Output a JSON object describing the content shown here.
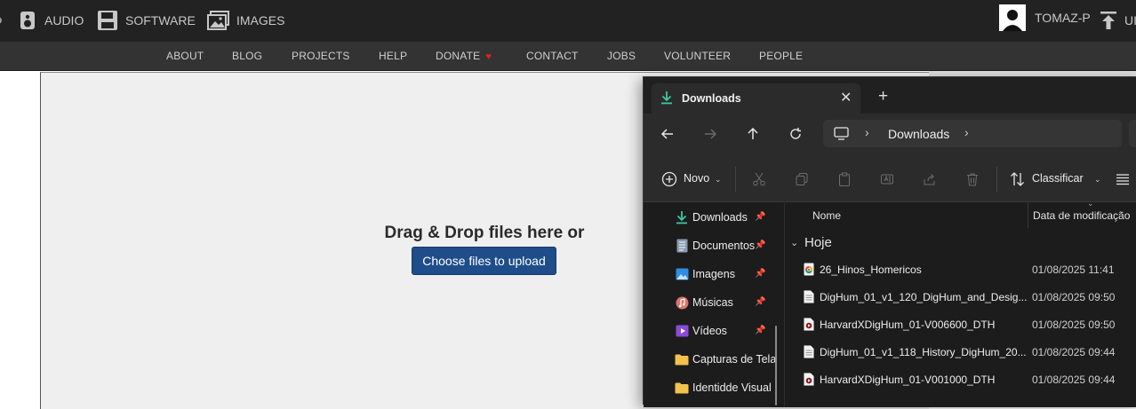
{
  "topnav": {
    "items": [
      "AUDIO",
      "SOFTWARE",
      "IMAGES"
    ],
    "user": "TOMAZ-P",
    "upload_partial": "UI"
  },
  "subnav": {
    "items": [
      "ABOUT",
      "BLOG",
      "PROJECTS",
      "HELP",
      "DONATE",
      "CONTACT",
      "JOBS",
      "VOLUNTEER",
      "PEOPLE"
    ],
    "donate_heart": "♥"
  },
  "upload": {
    "drop_text": "Drag & Drop files here or",
    "button_label": "Choose files to upload"
  },
  "explorer": {
    "tab_title": "Downloads",
    "tab_close": "✕",
    "tab_new": "+",
    "address": "Downloads",
    "toolbar": {
      "new_label": "Novo",
      "sort_label": "Classificar"
    },
    "sidebar": [
      {
        "label": "Downloads",
        "icon": "download-icon",
        "pinned": true
      },
      {
        "label": "Documentos",
        "icon": "document-icon",
        "pinned": true
      },
      {
        "label": "Imagens",
        "icon": "image-icon",
        "pinned": true
      },
      {
        "label": "Músicas",
        "icon": "music-icon",
        "pinned": true
      },
      {
        "label": "Vídeos",
        "icon": "video-icon",
        "pinned": true
      },
      {
        "label": "Capturas de Tela",
        "icon": "folder-icon",
        "pinned": false
      },
      {
        "label": "Identidde Visual",
        "icon": "folder-icon",
        "pinned": false
      }
    ],
    "columns": {
      "name": "Nome",
      "modified": "Data de modificação"
    },
    "group": "Hoje",
    "files": [
      {
        "name": "26_Hinos_Homericos",
        "date": "01/08/2025 11:41",
        "icon": "chrome-file-icon"
      },
      {
        "name": "DigHum_01_v1_120_DigHum_and_Desig...",
        "date": "01/08/2025 09:50",
        "icon": "text-file-icon"
      },
      {
        "name": "HarvardXDigHum_01-V006600_DTH",
        "date": "01/08/2025 09:50",
        "icon": "video-file-icon"
      },
      {
        "name": "DigHum_01_v1_118_History_DigHum_20...",
        "date": "01/08/2025 09:44",
        "icon": "text-file-icon"
      },
      {
        "name": "HarvardXDigHum_01-V001000_DTH",
        "date": "01/08/2025 09:44",
        "icon": "video-file-icon"
      }
    ]
  },
  "colors": {
    "topbar": "#222222",
    "subnav": "#333333",
    "upload_button": "#1f4d8a",
    "explorer_bg": "#1c1c1c",
    "accent_green": "#3cc8a0"
  }
}
